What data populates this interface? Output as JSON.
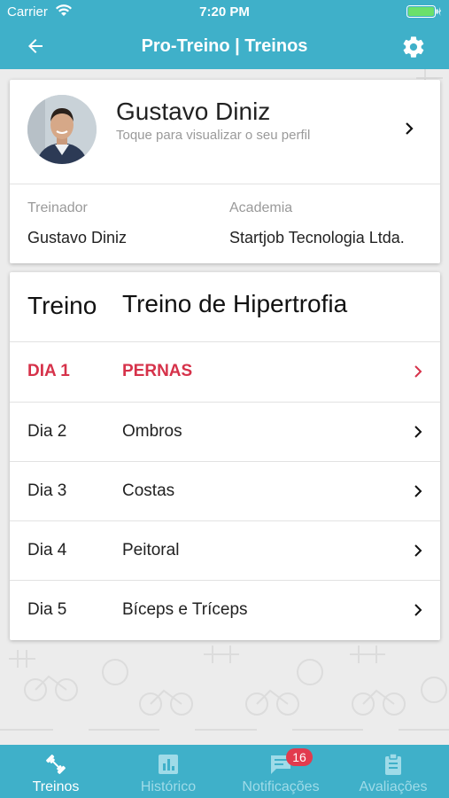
{
  "status_bar": {
    "carrier": "Carrier",
    "time": "7:20 PM"
  },
  "nav": {
    "title": "Pro-Treino | Treinos"
  },
  "profile": {
    "name": "Gustavo Diniz",
    "subtitle": "Toque para visualizar o seu perfil",
    "trainer_label": "Treinador",
    "trainer_value": "Gustavo Diniz",
    "gym_label": "Academia",
    "gym_value": "Startjob Tecnologia Ltda."
  },
  "plan": {
    "label": "Treino",
    "name": "Treino de Hipertrofia",
    "days": [
      {
        "day": "DIA 1",
        "name": "PERNAS",
        "active": true
      },
      {
        "day": "Dia 2",
        "name": "Ombros",
        "active": false
      },
      {
        "day": "Dia 3",
        "name": "Costas",
        "active": false
      },
      {
        "day": "Dia 4",
        "name": "Peitoral",
        "active": false
      },
      {
        "day": "Dia 5",
        "name": "Bíceps e Tríceps",
        "active": false
      }
    ]
  },
  "tabs": [
    {
      "label": "Treinos",
      "icon": "dumbbell-icon",
      "active": true
    },
    {
      "label": "Histórico",
      "icon": "chart-icon",
      "active": false
    },
    {
      "label": "Notificações",
      "icon": "chat-bubble-icon",
      "active": false,
      "badge": "16"
    },
    {
      "label": "Avaliações",
      "icon": "clipboard-icon",
      "active": false
    }
  ],
  "colors": {
    "primary": "#3fb0c9",
    "accent": "#d6324a",
    "badge": "#e23b4e"
  }
}
